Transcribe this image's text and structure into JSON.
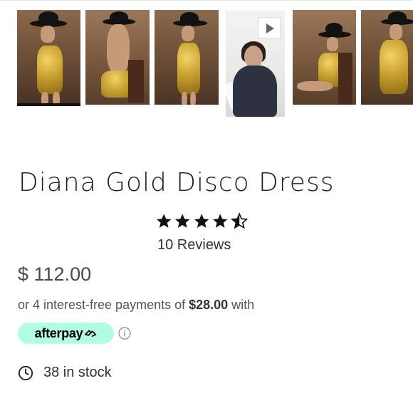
{
  "gallery": {
    "thumbnails": [
      {
        "kind": "photo",
        "selected": true
      },
      {
        "kind": "photo",
        "selected": false
      },
      {
        "kind": "photo",
        "selected": false
      },
      {
        "kind": "video",
        "selected": false,
        "icon": "play-icon"
      },
      {
        "kind": "photo",
        "selected": false
      },
      {
        "kind": "photo",
        "selected": false
      }
    ]
  },
  "product": {
    "title": "Diana Gold Disco Dress",
    "rating": 4.5,
    "rating_max": 5,
    "reviews_label": "10 Reviews",
    "price": "$ 112.00"
  },
  "payments": {
    "prefix": "or 4 interest-free payments of ",
    "amount": "$28.00",
    "suffix": " with",
    "provider_label": "afterpay",
    "provider_color": "#b2fce4",
    "info_icon": "info-icon"
  },
  "stock": {
    "icon": "clock-icon",
    "label": "38 in stock"
  }
}
